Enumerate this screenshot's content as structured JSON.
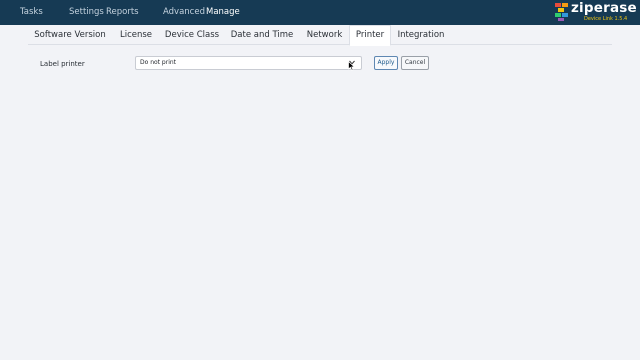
{
  "nav": {
    "tasks": "Tasks",
    "settings": "Settings",
    "reports": "Reports",
    "advanced": "Advanced",
    "manage": "Manage",
    "active": "manage"
  },
  "brand": {
    "name": "ziperase",
    "subtitle": "Device Link 1.5.4",
    "colors": {
      "bar": "#163a54",
      "accent": "#f1c40f"
    }
  },
  "tabs": {
    "items": [
      "Software Version",
      "License",
      "Device Class",
      "Date and Time",
      "Network",
      "Printer",
      "Integration"
    ],
    "active": "Printer"
  },
  "form": {
    "label_printer": "Label printer",
    "label_printer_value": "Do not print",
    "apply_label": "Apply",
    "cancel_label": "Cancel"
  }
}
